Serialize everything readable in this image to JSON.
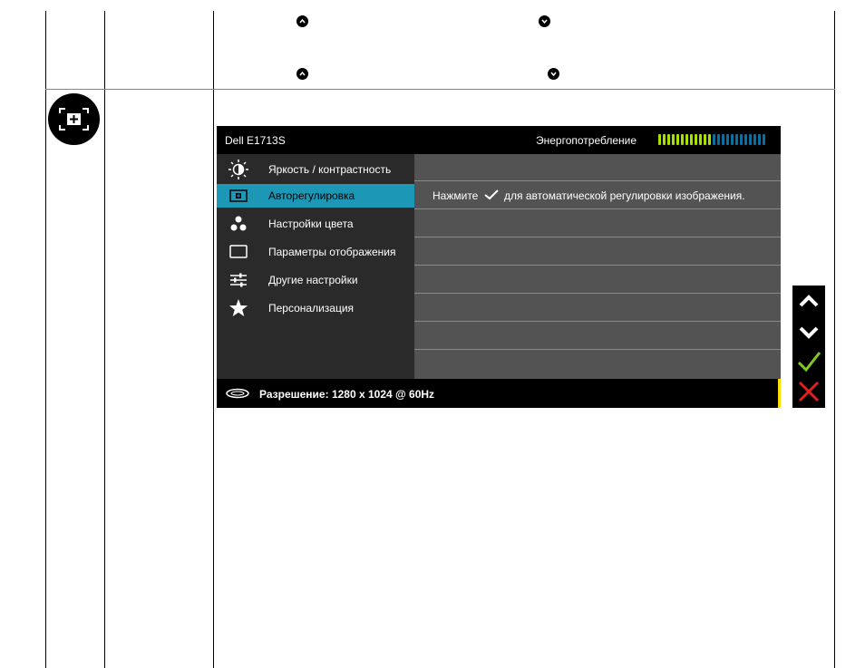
{
  "osd": {
    "model": "Dell E1713S",
    "energy_label": "Энергопотребление",
    "energy_level": 0.5,
    "menu": [
      {
        "label": "Яркость / контрастность",
        "icon": "brightness-icon"
      },
      {
        "label": "Авторегулировка",
        "icon": "auto-adjust-icon",
        "selected": true
      },
      {
        "label": "Настройки цвета",
        "icon": "color-settings-icon"
      },
      {
        "label": "Параметры отображения",
        "icon": "display-settings-icon"
      },
      {
        "label": "Другие настройки",
        "icon": "other-settings-icon"
      },
      {
        "label": "Персонализация",
        "icon": "star-icon"
      }
    ],
    "auto_adjust_message_pre": "Нажмите",
    "auto_adjust_message_post": "для автоматической регулировки изображения.",
    "footer_resolution": "Разрешение: 1280 x 1024 @ 60Hz",
    "accent_color": "#1d97b6",
    "energy_on_color": "#a8e000",
    "energy_off_color": "#0b6fa0"
  },
  "side_buttons": [
    "up-icon",
    "down-icon",
    "check-icon",
    "close-icon"
  ]
}
